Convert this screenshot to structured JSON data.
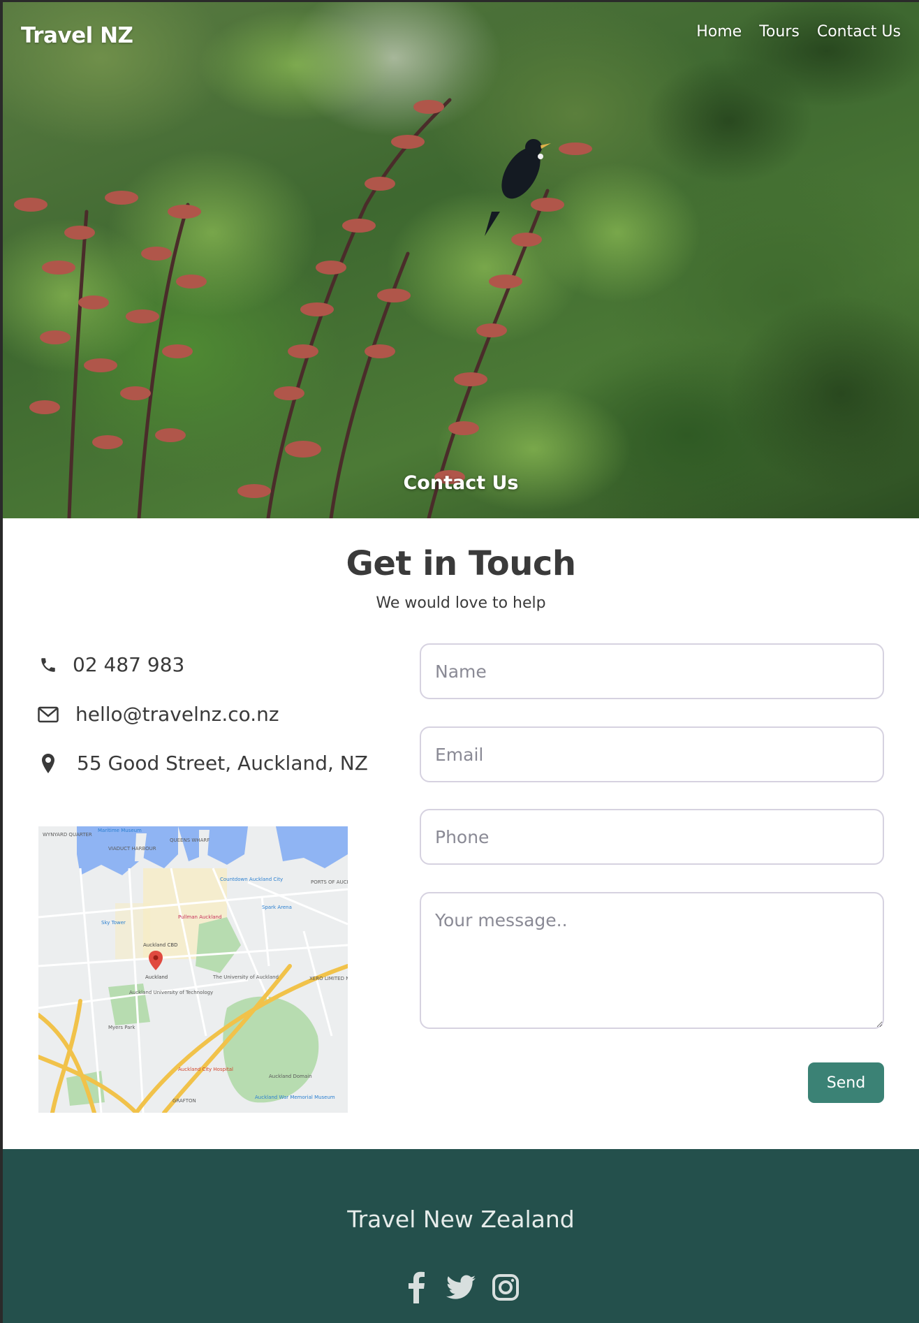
{
  "header": {
    "brand": "Travel NZ",
    "nav": [
      {
        "label": "Home"
      },
      {
        "label": "Tours"
      },
      {
        "label": "Contact Us"
      }
    ],
    "hero_title": "Contact Us"
  },
  "main": {
    "title": "Get in Touch",
    "subtitle": "We would love to help",
    "contact": {
      "phone": "02 487 983",
      "email": "hello@travelnz.co.nz",
      "address": "55 Good Street, Auckland, NZ"
    },
    "map_labels": {
      "wynyard": "WYNYARD QUARTER",
      "viaduct": "VIADUCT HARBOUR",
      "queens_wharf": "QUEENS WHARF",
      "ports": "PORTS OF AUCKLAND",
      "cbd": "Auckland CBD",
      "auckland": "Auckland",
      "sky_tower": "Sky Tower",
      "spark_arena": "Spark Arena",
      "university": "The University of Auckland",
      "aut": "Auckland University of Technology",
      "domain": "Auckland Domain",
      "hospital": "Auckland City Hospital",
      "museum": "Auckland War Memorial Museum",
      "maritime": "Maritime Museum",
      "countdown": "Countdown Auckland City",
      "pullman": "Pullman Auckland",
      "xero": "XERO LIMITED NZ",
      "myers_park": "Myers Park",
      "grafton": "GRAFTON"
    }
  },
  "form": {
    "name_placeholder": "Name",
    "email_placeholder": "Email",
    "phone_placeholder": "Phone",
    "message_placeholder": "Your message..",
    "send_label": "Send"
  },
  "footer": {
    "title": "Travel New Zealand",
    "socials": [
      {
        "icon": "facebook-icon"
      },
      {
        "icon": "twitter-icon"
      },
      {
        "icon": "instagram-icon"
      }
    ]
  },
  "colors": {
    "accent": "#3b8275",
    "footer_bg": "#24504c",
    "text_dark": "#3a3a3a"
  }
}
